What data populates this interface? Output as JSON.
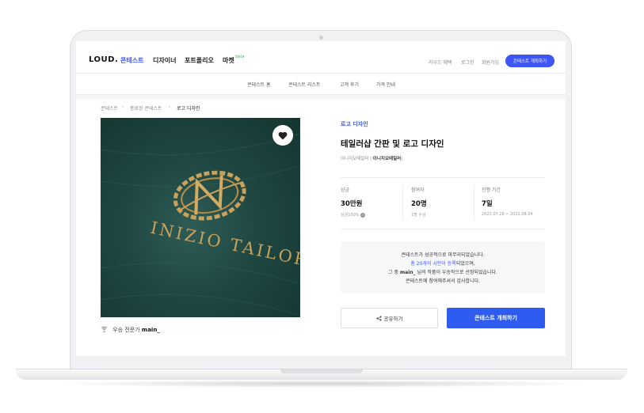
{
  "header": {
    "logo": "LOUD.",
    "nav": [
      "콘테스트",
      "디자이너",
      "포트폴리오",
      "마켓"
    ],
    "beta": "beta",
    "util": [
      "라우드 혜택",
      "로그인",
      "회원가입"
    ],
    "cta": "콘테스트 개최하기"
  },
  "subnav": [
    "콘테스트 홈",
    "콘테스트 리스트",
    "고객 후기",
    "가격 안내"
  ],
  "breadcrumb": [
    "콘테스트",
    "종료된 콘테스트",
    "로고 디자인"
  ],
  "hero": {
    "brand_text": "INIZIO TAILOR",
    "winner_prefix": "우승 전문가",
    "winner_name": "main_"
  },
  "detail": {
    "category": "로고 디자인",
    "title": "테일러샵 간판 및 로고 디자인",
    "client_prefix": "이니지오테일러 |",
    "client_name": "이니지오테일러",
    "stats": [
      {
        "label": "상금",
        "value": "30만원",
        "sub": "상금100%"
      },
      {
        "label": "참여자",
        "value": "20명",
        "sub": "1명 수상"
      },
      {
        "label": "진행 기간",
        "value": "7일",
        "sub": "2022.07.28 ~ 2022.08.04"
      }
    ],
    "notice": {
      "line1": "콘테스트가 성공적으로 마무리되었습니다.",
      "line2_hl": "총 20개의 시안이 등록",
      "line2_rest": "되었으며,",
      "line3_a": "그 중 ",
      "line3_b": "main_",
      "line3_c": " 님의 작품이 우승작으로 선정되었습니다.",
      "line4": "콘테스트에 참여해주셔서 감사합니다."
    },
    "share_label": "공유하기",
    "host_label": "콘테스트 개최하기"
  },
  "colors": {
    "accent": "#3d56f5",
    "cta": "#2e5bf0",
    "fabric": "#1f4742",
    "gold": "#c9a15a"
  }
}
